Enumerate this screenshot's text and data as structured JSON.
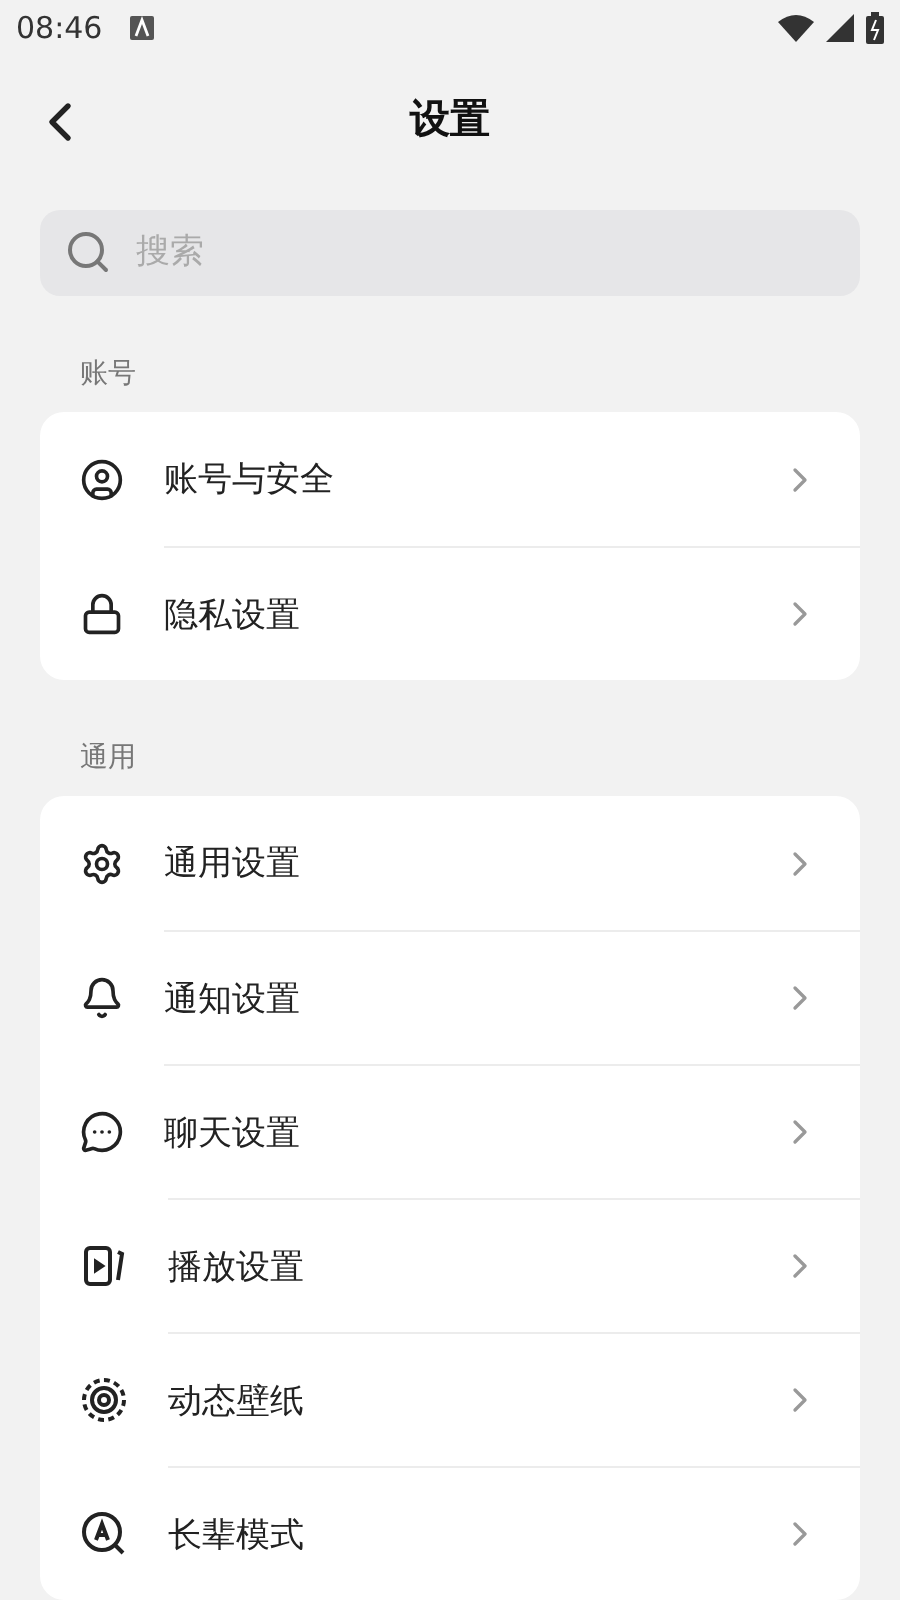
{
  "status_bar": {
    "time": "08:46"
  },
  "header": {
    "title": "设置"
  },
  "search": {
    "placeholder": "搜索"
  },
  "sections": [
    {
      "title": "账号",
      "items": [
        {
          "label": "账号与安全"
        },
        {
          "label": "隐私设置"
        }
      ]
    },
    {
      "title": "通用",
      "items": [
        {
          "label": "通用设置"
        },
        {
          "label": "通知设置"
        },
        {
          "label": "聊天设置"
        },
        {
          "label": "播放设置"
        },
        {
          "label": "动态壁纸"
        },
        {
          "label": "长辈模式"
        }
      ]
    }
  ]
}
